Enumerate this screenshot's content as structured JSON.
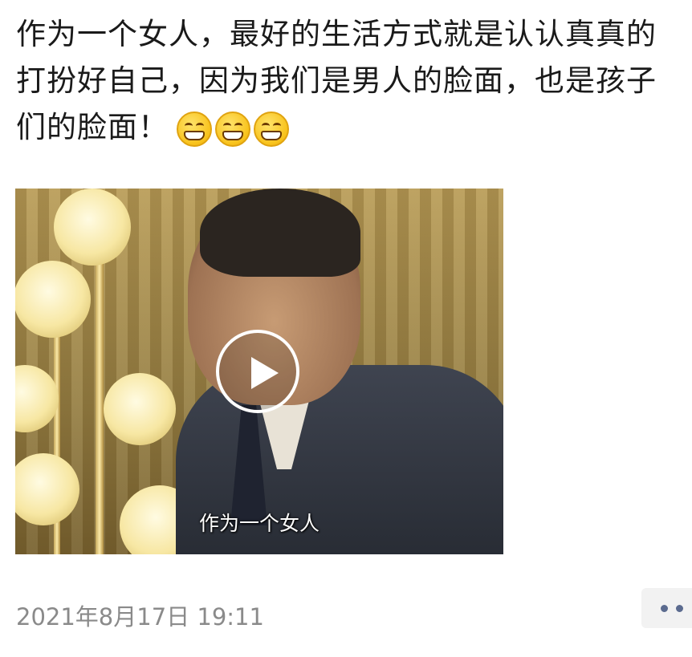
{
  "post": {
    "text": "作为一个女人，最好的生活方式就是认认真真的打扮好自己，因为我们是男人的脸面，也是孩子们的脸面！",
    "emojis": [
      "grin-icon",
      "grin-icon",
      "grin-icon"
    ]
  },
  "video": {
    "subtitle": "作为一个女人",
    "play_icon": "play-icon"
  },
  "footer": {
    "timestamp": "2021年8月17日 19:11",
    "more_icon": "more-dots-icon"
  }
}
